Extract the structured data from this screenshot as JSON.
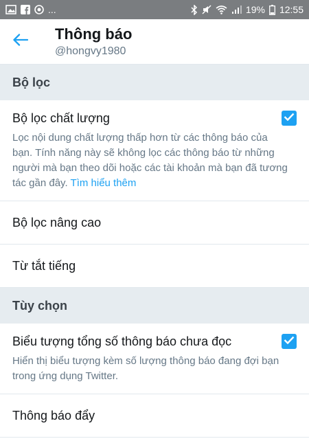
{
  "status_bar": {
    "battery": "19%",
    "time": "12:55",
    "dots": "..."
  },
  "header": {
    "title": "Thông báo",
    "subtitle": "@hongvy1980"
  },
  "sections": [
    {
      "header": "Bộ lọc",
      "quality_filter": {
        "title": "Bộ lọc chất lượng",
        "description": "Lọc nội dung chất lượng thấp hơn từ các thông báo của bạn. Tính năng này sẽ không lọc các thông báo từ những người mà bạn theo dõi hoặc các tài khoản mà bạn đã tương tác gần đây.",
        "link": "Tìm hiểu thêm",
        "checked": true
      },
      "advanced_filter": "Bộ lọc nâng cao",
      "muted_words": "Từ tắt tiếng"
    },
    {
      "header": "Tùy chọn",
      "unread_badge": {
        "title": "Biểu tượng tổng số thông báo chưa đọc",
        "description": "Hiển thị biểu tượng kèm số lượng thông báo đang đợi bạn trong ứng dụng Twitter.",
        "checked": true
      },
      "push_notifications": "Thông báo đẩy"
    }
  ],
  "colors": {
    "accent": "#1da1f2",
    "section_bg": "#e6ecf0",
    "status_bar": "#7a7d80"
  }
}
